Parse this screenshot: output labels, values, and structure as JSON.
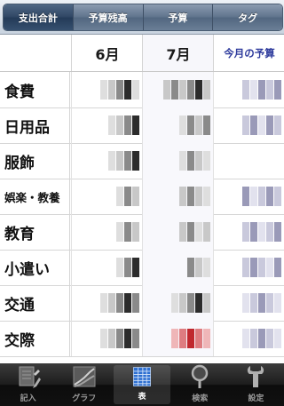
{
  "segments": [
    {
      "label": "支出合計",
      "active": true
    },
    {
      "label": "予算残高",
      "active": false
    },
    {
      "label": "予算",
      "active": false
    },
    {
      "label": "タグ",
      "active": false
    }
  ],
  "table": {
    "headers": {
      "month1": "6月",
      "month2": "7月",
      "budget": "今月の予算"
    },
    "rows": [
      {
        "label": "食費"
      },
      {
        "label": "日用品"
      },
      {
        "label": "服飾"
      },
      {
        "label": "娯楽・教養"
      },
      {
        "label": "教育"
      },
      {
        "label": "小遣い"
      },
      {
        "label": "交通"
      },
      {
        "label": "交際"
      }
    ]
  },
  "tabs": [
    {
      "label": "記入",
      "icon": "pencil-icon",
      "active": false
    },
    {
      "label": "グラフ",
      "icon": "graph-icon",
      "active": false
    },
    {
      "label": "表",
      "icon": "table-icon",
      "active": true
    },
    {
      "label": "検索",
      "icon": "search-icon",
      "active": false
    },
    {
      "label": "設定",
      "icon": "wrench-icon",
      "active": false
    }
  ],
  "colors": {
    "accent": "#2d3a9c",
    "tabbar": "#111111",
    "highlight": "#c0282e"
  }
}
